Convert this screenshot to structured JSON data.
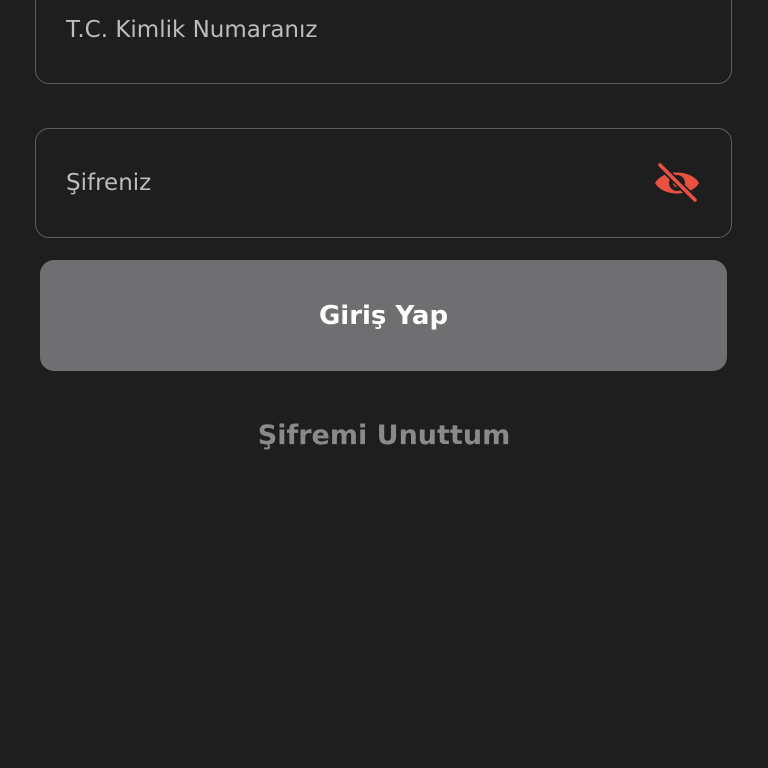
{
  "login_form": {
    "tc_field": {
      "placeholder": "T.C. Kimlik Numaranız",
      "value": ""
    },
    "password_field": {
      "placeholder": "Şifreniz",
      "value": "",
      "visibility_icon": "eye-off-icon"
    },
    "login_button_label": "Giriş Yap",
    "forgot_password_label": "Şifremi Unuttum"
  },
  "colors": {
    "background": "#1e1e1f",
    "field_border": "#5e5e60",
    "button_background": "#6f6f71",
    "accent_icon": "#e8513f",
    "link_text": "#8a8a8c"
  }
}
